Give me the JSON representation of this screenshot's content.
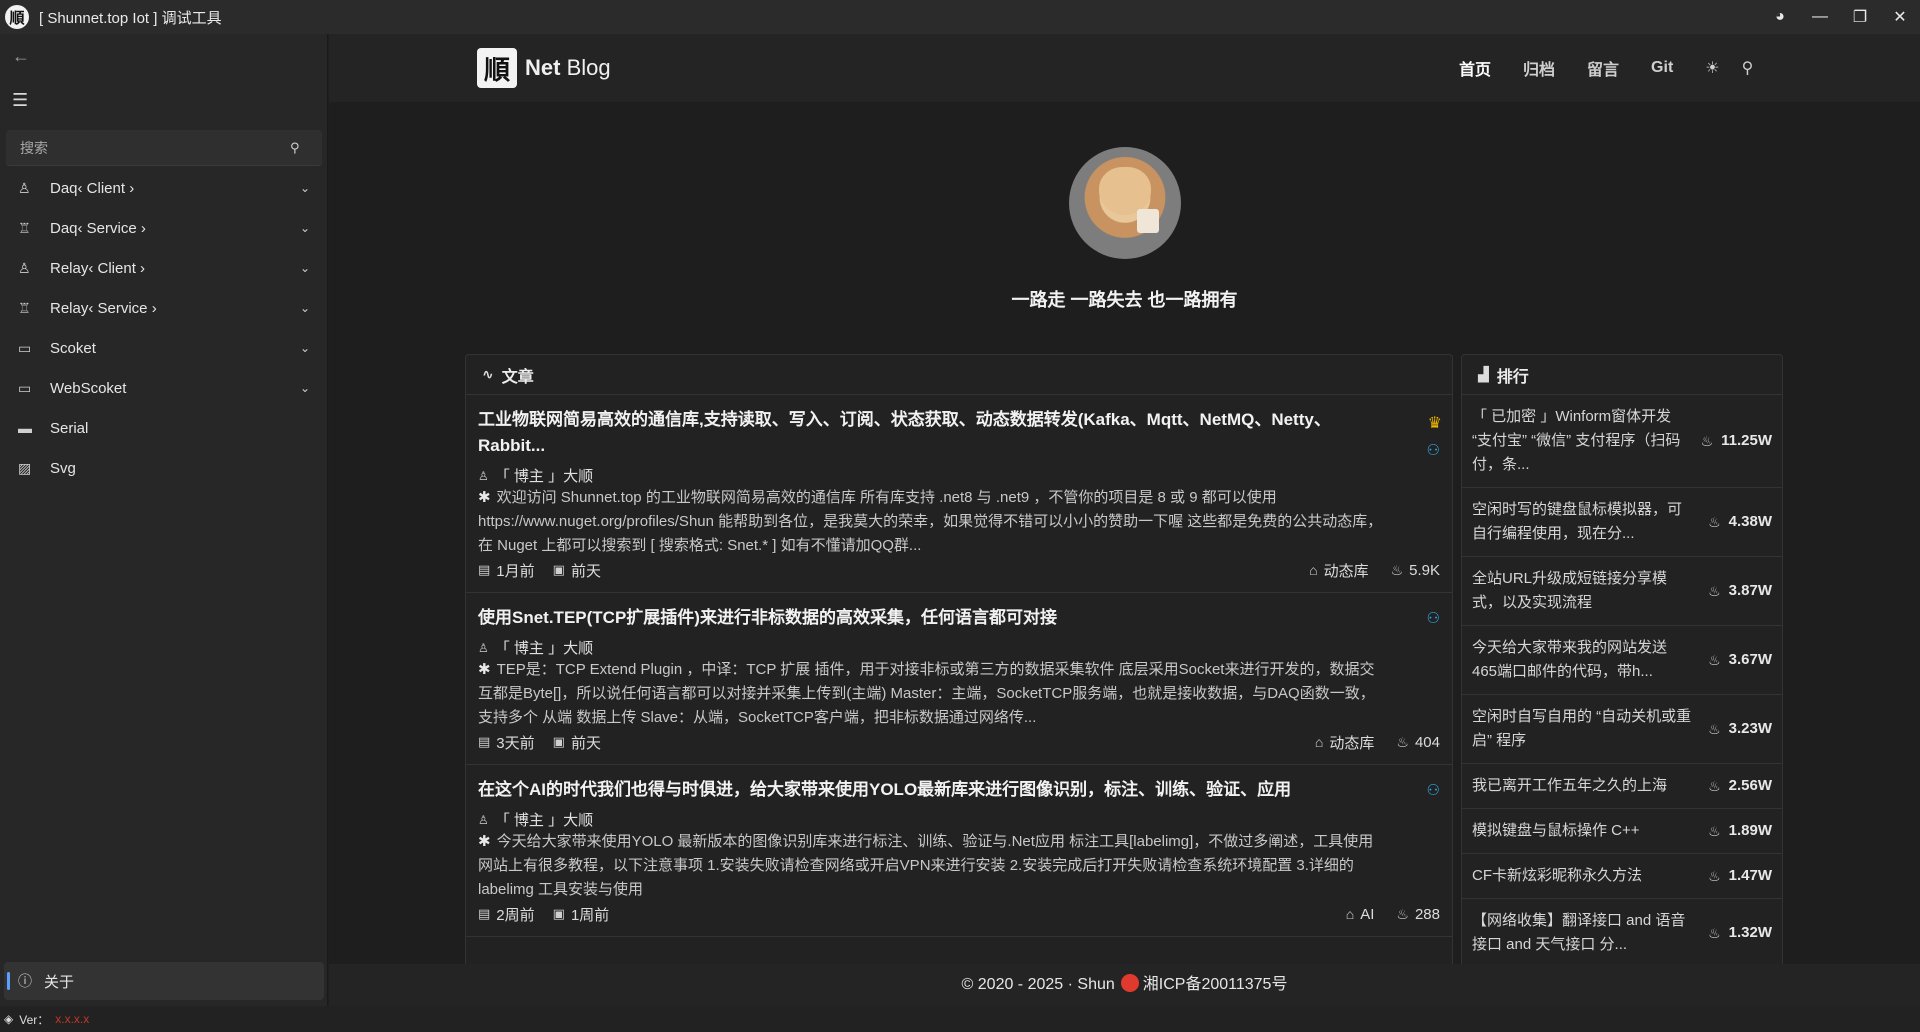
{
  "window": {
    "title": "[ Shunnet.top Iot ] 调试工具",
    "logo_char": "順"
  },
  "sidebar": {
    "search_placeholder": "搜索",
    "items": [
      {
        "label": "Daq‹ Client ›",
        "icon": "client-icon",
        "expandable": true
      },
      {
        "label": "Daq‹ Service ›",
        "icon": "service-icon",
        "expandable": true
      },
      {
        "label": "Relay‹ Client ›",
        "icon": "client-icon",
        "expandable": true
      },
      {
        "label": "Relay‹ Service ›",
        "icon": "service-icon",
        "expandable": true
      },
      {
        "label": "Scoket",
        "icon": "monitor-icon",
        "expandable": true
      },
      {
        "label": "WebScoket",
        "icon": "monitor-icon",
        "expandable": true
      },
      {
        "label": "Serial",
        "icon": "serial-icon",
        "expandable": false
      },
      {
        "label": "Svg",
        "icon": "image-icon",
        "expandable": false
      }
    ],
    "about_label": "关于"
  },
  "statusbar": {
    "ver_label": "Ver：",
    "ver_value": "x.x.x.x"
  },
  "site": {
    "logo_char": "順",
    "brand_bold": "Net",
    "brand_rest": " Blog",
    "nav": [
      {
        "label": "首页",
        "active": true
      },
      {
        "label": "归档",
        "active": false
      },
      {
        "label": "留言",
        "active": false
      },
      {
        "label": "Git",
        "active": false
      }
    ],
    "motto": "一路走 一路失去 也一路拥有"
  },
  "articles_panel": {
    "heading": "文章",
    "items": [
      {
        "title": "工业物联网简易高效的通信库,支持读取、写入、订阅、状态获取、动态数据转发(Kafka、Mqtt、NetMQ、Netty、Rabbit...",
        "author": "「 博主 」大顺",
        "summary": "欢迎访问 Shunnet.top 的工业物联网简易高效的通信库 所有库支持 .net8 与 .net9 ，不管你的项目是 8 或 9 都可以使用 https://www.nuget.org/profiles/Shun 能帮助到各位，是我莫大的荣幸，如果觉得不错可以小小的赞助一下喔 这些都是免费的公共动态库，在 Nuget 上都可以搜索到 [ 搜索格式: Snet.* ] 如有不懂请加QQ群...",
        "published": "1月前",
        "updated": "前天",
        "tag": "动态库",
        "views": "5.9K",
        "crown": true
      },
      {
        "title": "使用Snet.TEP(TCP扩展插件)来进行非标数据的高效采集，任何语言都可对接",
        "author": "「 博主 」大顺",
        "summary": "TEP是：TCP Extend Plugin ，中译：TCP 扩展 插件，用于对接非标或第三方的数据采集软件 底层采用Socket来进行开发的，数据交互都是Byte[]，所以说任何语言都可以对接并采集上传到(主端) Master：主端，SocketTCP服务端，也就是接收数据，与DAQ函数一致，支持多个 从端 数据上传 Slave：从端，SocketTCP客户端，把非标数据通过网络传...",
        "published": "3天前",
        "updated": "前天",
        "tag": "动态库",
        "views": "404",
        "crown": false
      },
      {
        "title": "在这个AI的时代我们也得与时俱进，给大家带来使用YOLO最新库来进行图像识别，标注、训练、验证、应用",
        "author": "「 博主 」大顺",
        "summary": "今天给大家带来使用YOLO 最新版本的图像识别库来进行标注、训练、验证与.Net应用 标注工具[labelimg]，不做过多阐述，工具使用网站上有很多教程，以下注意事项 1.安装失败请检查网络或开启VPN来进行安装 2.安装完成后打开失败请检查系统环境配置 3.详细的labelimg 工具安装与使用",
        "published": "2周前",
        "updated": "1周前",
        "tag": "AI",
        "views": "288",
        "crown": false
      }
    ]
  },
  "ranking_panel": {
    "heading": "排行",
    "items": [
      {
        "title": "「 已加密 」Winform窗体开发 “支付宝” “微信” 支付程序（扫码付，条...",
        "score": "11.25W"
      },
      {
        "title": "空闲时写的键盘鼠标模拟器，可自行编程使用，现在分...",
        "score": "4.38W"
      },
      {
        "title": "全站URL升级成短链接分享模式，以及实现流程",
        "score": "3.87W"
      },
      {
        "title": "今天给大家带来我的网站发送465端口邮件的代码，带h...",
        "score": "3.67W"
      },
      {
        "title": "空闲时自写自用的 “自动关机或重启” 程序",
        "score": "3.23W"
      },
      {
        "title": "我已离开工作五年之久的上海",
        "score": "2.56W"
      },
      {
        "title": "模拟键盘与鼠标操作 C++",
        "score": "1.89W"
      },
      {
        "title": "CF卡新炫彩昵称永久方法",
        "score": "1.47W"
      },
      {
        "title": "【网络收集】翻译接口 and 语音接口 and 天气接口 分...",
        "score": "1.32W"
      }
    ]
  },
  "footer": {
    "copyright": "© 2020 - 2025 · Shun",
    "icp": "湘ICP备20011375号"
  },
  "colors": {
    "accent_blue": "#2fa8e0",
    "crown_gold": "#f0b400",
    "version_red": "#c0392b"
  }
}
